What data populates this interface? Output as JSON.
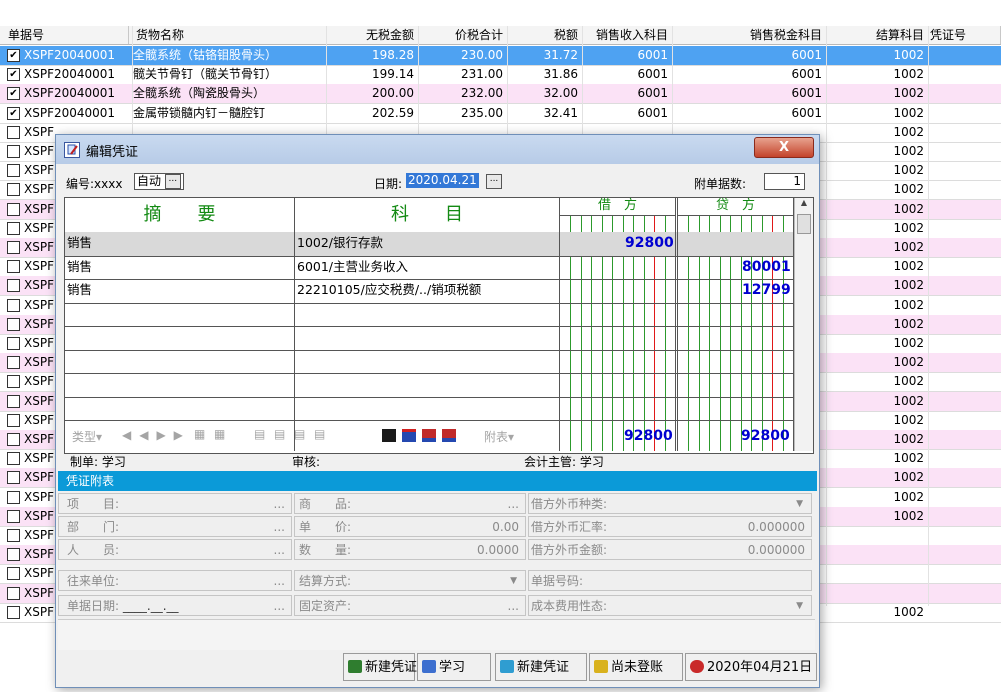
{
  "table": {
    "headers": [
      "单据号",
      "货物名称",
      "无税金额",
      "价税合计",
      "税额",
      "销售收入科目",
      "销售税金科目",
      "结算科目",
      "凭证号"
    ],
    "rows": [
      {
        "checked": true,
        "selected": true,
        "pink": false,
        "doc": "XSPF20040001",
        "goods": "全髋系统（钴铬钼股骨头）",
        "notax": "198.28",
        "total": "230.00",
        "tax": "31.72",
        "rev": "6001",
        "taxacc": "6001",
        "settle": "1002"
      },
      {
        "checked": true,
        "selected": false,
        "pink": false,
        "doc": "XSPF20040001",
        "goods": "髋关节骨钉（髋关节骨钉）",
        "notax": "199.14",
        "total": "231.00",
        "tax": "31.86",
        "rev": "6001",
        "taxacc": "6001",
        "settle": "1002"
      },
      {
        "checked": true,
        "selected": false,
        "pink": true,
        "doc": "XSPF20040001",
        "goods": "全髋系统（陶瓷股骨头）",
        "notax": "200.00",
        "total": "232.00",
        "tax": "32.00",
        "rev": "6001",
        "taxacc": "6001",
        "settle": "1002"
      },
      {
        "checked": true,
        "selected": false,
        "pink": false,
        "doc": "XSPF20040001",
        "goods": "金属带锁髓内钉－髓腔钉",
        "notax": "202.59",
        "total": "235.00",
        "tax": "32.41",
        "rev": "6001",
        "taxacc": "6001",
        "settle": "1002"
      },
      {
        "checked": false,
        "selected": false,
        "pink": false,
        "doc": "XSPF",
        "settle": "1002"
      },
      {
        "checked": false,
        "selected": false,
        "pink": false,
        "doc": "XSPF",
        "settle": "1002"
      },
      {
        "checked": false,
        "selected": false,
        "pink": false,
        "doc": "XSPF",
        "settle": "1002"
      },
      {
        "checked": false,
        "selected": false,
        "pink": false,
        "doc": "XSPF",
        "settle": "1002"
      },
      {
        "checked": false,
        "selected": false,
        "pink": true,
        "doc": "XSPF",
        "settle": "1002"
      },
      {
        "checked": false,
        "selected": false,
        "pink": false,
        "doc": "XSPF",
        "settle": "1002"
      },
      {
        "checked": false,
        "selected": false,
        "pink": true,
        "doc": "XSPF",
        "settle": "1002"
      },
      {
        "checked": false,
        "selected": false,
        "pink": false,
        "doc": "XSPF",
        "settle": "1002"
      },
      {
        "checked": false,
        "selected": false,
        "pink": true,
        "doc": "XSPF",
        "settle": "1002"
      },
      {
        "checked": false,
        "selected": false,
        "pink": false,
        "doc": "XSPF",
        "settle": "1002"
      },
      {
        "checked": false,
        "selected": false,
        "pink": true,
        "doc": "XSPF",
        "settle": "1002"
      },
      {
        "checked": false,
        "selected": false,
        "pink": false,
        "doc": "XSPF",
        "settle": "1002"
      },
      {
        "checked": false,
        "selected": false,
        "pink": true,
        "doc": "XSPF",
        "settle": "1002"
      },
      {
        "checked": false,
        "selected": false,
        "pink": false,
        "doc": "XSPF",
        "settle": "1002"
      },
      {
        "checked": false,
        "selected": false,
        "pink": true,
        "doc": "XSPF",
        "settle": "1002"
      },
      {
        "checked": false,
        "selected": false,
        "pink": false,
        "doc": "XSPF",
        "settle": "1002"
      },
      {
        "checked": false,
        "selected": false,
        "pink": true,
        "doc": "XSPF",
        "settle": "1002"
      },
      {
        "checked": false,
        "selected": false,
        "pink": false,
        "doc": "XSPF",
        "settle": "1002"
      },
      {
        "checked": false,
        "selected": false,
        "pink": true,
        "doc": "XSPF",
        "settle": "1002"
      },
      {
        "checked": false,
        "selected": false,
        "pink": false,
        "doc": "XSPF",
        "settle": "1002"
      },
      {
        "checked": false,
        "selected": false,
        "pink": true,
        "doc": "XSPF",
        "settle": "1002"
      },
      {
        "checked": false,
        "selected": false,
        "pink": false,
        "doc": "XSPF",
        "settle": ""
      },
      {
        "checked": false,
        "selected": false,
        "pink": true,
        "doc": "XSPF",
        "settle": ""
      },
      {
        "checked": false,
        "selected": false,
        "pink": false,
        "doc": "XSPF",
        "settle": ""
      },
      {
        "checked": false,
        "selected": false,
        "pink": true,
        "doc": "XSPF",
        "settle": ""
      },
      {
        "checked": false,
        "selected": false,
        "pink": false,
        "doc": "XSPF",
        "settle": "1002"
      }
    ]
  },
  "dialog": {
    "title": "编辑凭证",
    "close_glyph": "X",
    "number_label": "编号:xxxx",
    "number_mode": "自动",
    "date_label": "日期:",
    "date_value": "2020.04.21",
    "attach_label": "附单据数:",
    "attach_count": "1",
    "col_summary": "摘　　要",
    "col_subject": "科　　目",
    "col_debit": "借　方",
    "col_credit": "贷　方",
    "entries": [
      {
        "summary": "销售",
        "subject": "1002/银行存款",
        "debit": "92800",
        "credit": ""
      },
      {
        "summary": "销售",
        "subject": "6001/主营业务收入",
        "debit": "",
        "credit": "80001"
      },
      {
        "summary": "销售",
        "subject": "22210105/应交税费/../销项税额",
        "debit": "",
        "credit": "12799"
      }
    ],
    "total_debit": "92800",
    "total_credit": "92800",
    "toolbar": {
      "type_label": "类型▾",
      "attach_label": "附表▾"
    },
    "maker_label": "制单: 学习",
    "audit_label": "审核:",
    "supervisor_label": "会计主管: 学习",
    "attach_header": "凭证附表",
    "fields": {
      "item": "项　　目:",
      "dept": "部　　门:",
      "staff": "人　　员:",
      "partner": "往来单位:",
      "docdate": "单据日期:",
      "docdate_value": "____.__.__",
      "goods": "商　　品:",
      "price": "单　　价:",
      "price_value": "0.00",
      "qty": "数　　量:",
      "qty_value": "0.0000",
      "settle": "结算方式:",
      "asset": "固定资产:",
      "fx_type": "借方外币种类:",
      "fx_rate": "借方外币汇率:",
      "fx_rate_value": "0.000000",
      "fx_amount": "借方外币金额:",
      "fx_amount_value": "0.000000",
      "docno": "单据号码:",
      "costtype": "成本费用性态:"
    },
    "status": {
      "new1": "新建凭证",
      "user": "学习",
      "new2": "新建凭证",
      "posting": "尚未登账",
      "date": "2020年04月21日"
    }
  }
}
